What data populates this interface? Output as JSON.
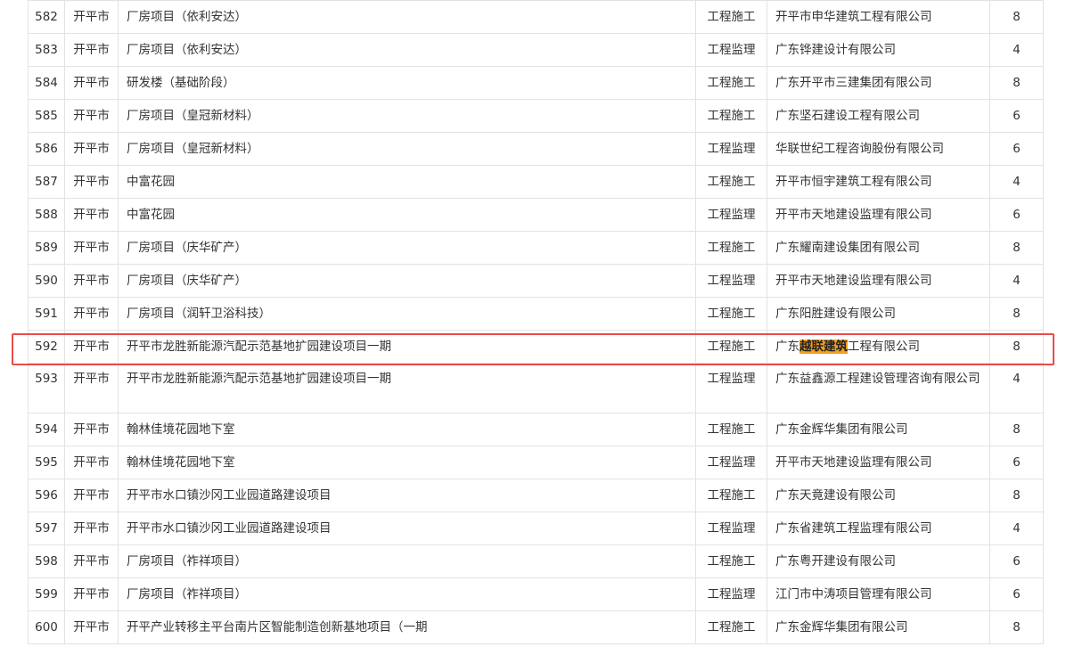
{
  "rows": [
    {
      "no": "582",
      "city": "开平市",
      "project": "厂房项目（依利安达）",
      "type": "工程施工",
      "company": "开平市申华建筑工程有限公司",
      "score": "8"
    },
    {
      "no": "583",
      "city": "开平市",
      "project": "厂房项目（依利安达）",
      "type": "工程监理",
      "company": "广东铧建设计有限公司",
      "score": "4"
    },
    {
      "no": "584",
      "city": "开平市",
      "project": "研发楼（基础阶段）",
      "type": "工程施工",
      "company": "广东开平市三建集团有限公司",
      "score": "8"
    },
    {
      "no": "585",
      "city": "开平市",
      "project": "厂房项目（皇冠新材料）",
      "type": "工程施工",
      "company": "广东坚石建设工程有限公司",
      "score": "6"
    },
    {
      "no": "586",
      "city": "开平市",
      "project": "厂房项目（皇冠新材料）",
      "type": "工程监理",
      "company": "华联世纪工程咨询股份有限公司",
      "score": "6"
    },
    {
      "no": "587",
      "city": "开平市",
      "project": "中富花园",
      "type": "工程施工",
      "company": "开平市恒宇建筑工程有限公司",
      "score": "4"
    },
    {
      "no": "588",
      "city": "开平市",
      "project": "中富花园",
      "type": "工程监理",
      "company": "开平市天地建设监理有限公司",
      "score": "6"
    },
    {
      "no": "589",
      "city": "开平市",
      "project": "厂房项目（庆华矿产）",
      "type": "工程施工",
      "company": "广东耀南建设集团有限公司",
      "score": "8"
    },
    {
      "no": "590",
      "city": "开平市",
      "project": "厂房项目（庆华矿产）",
      "type": "工程监理",
      "company": "开平市天地建设监理有限公司",
      "score": "4"
    },
    {
      "no": "591",
      "city": "开平市",
      "project": "厂房项目（润轩卫浴科技）",
      "type": "工程施工",
      "company": "广东阳胜建设有限公司",
      "score": "8"
    },
    {
      "no": "592",
      "city": "开平市",
      "project": "开平市龙胜新能源汽配示范基地扩园建设项目一期",
      "type": "工程施工",
      "company_pre": "广东",
      "company_hl": "越联建筑",
      "company_post": "工程有限公司",
      "score": "8"
    },
    {
      "no": "593",
      "city": "开平市",
      "project": "开平市龙胜新能源汽配示范基地扩园建设项目一期",
      "type": "工程监理",
      "company": "广东益鑫源工程建设管理咨询有限公司",
      "score": "4"
    },
    {
      "no": "594",
      "city": "开平市",
      "project": "翰林佳境花园地下室",
      "type": "工程施工",
      "company": "广东金辉华集团有限公司",
      "score": "8"
    },
    {
      "no": "595",
      "city": "开平市",
      "project": "翰林佳境花园地下室",
      "type": "工程监理",
      "company": "开平市天地建设监理有限公司",
      "score": "6"
    },
    {
      "no": "596",
      "city": "开平市",
      "project": "开平市水口镇沙冈工业园道路建设项目",
      "type": "工程施工",
      "company": "广东天竟建设有限公司",
      "score": "8"
    },
    {
      "no": "597",
      "city": "开平市",
      "project": "开平市水口镇沙冈工业园道路建设项目",
      "type": "工程监理",
      "company": "广东省建筑工程监理有限公司",
      "score": "4"
    },
    {
      "no": "598",
      "city": "开平市",
      "project": "厂房项目（祚祥项目）",
      "type": "工程施工",
      "company": "广东粤开建设有限公司",
      "score": "6"
    },
    {
      "no": "599",
      "city": "开平市",
      "project": "厂房项目（祚祥项目）",
      "type": "工程监理",
      "company": "江门市中涛项目管理有限公司",
      "score": "6"
    },
    {
      "no": "600",
      "city": "开平市",
      "project": "开平产业转移主平台南片区智能制造创新基地项目（一期",
      "type": "工程施工",
      "company": "广东金辉华集团有限公司",
      "score": "8"
    }
  ],
  "colors": {
    "highlight_bg": "#f5a020",
    "selection_border": "#e94b4b",
    "grid": "#e2e2e2",
    "text": "#333333"
  }
}
